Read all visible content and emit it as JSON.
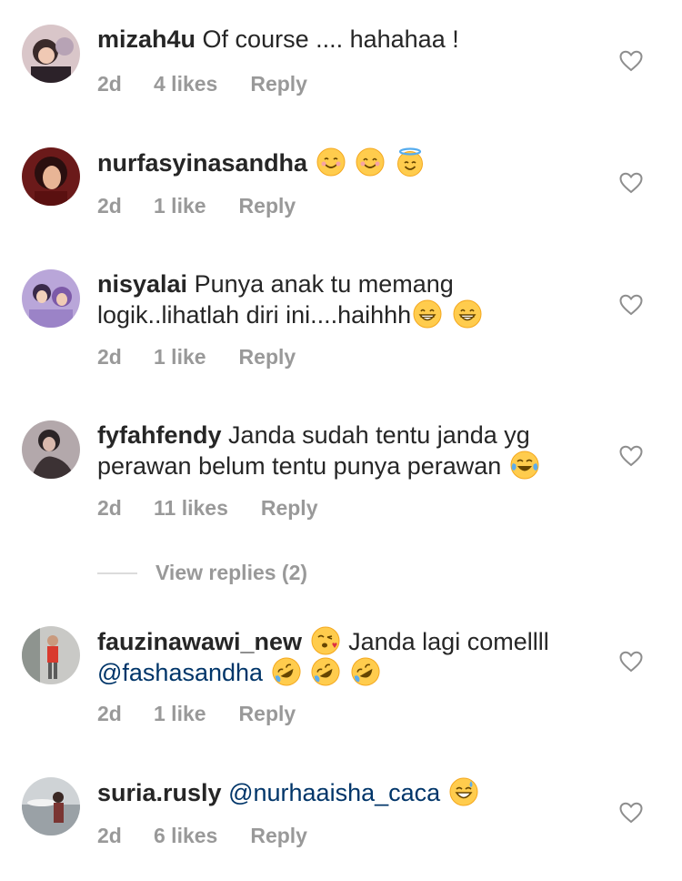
{
  "comments": [
    {
      "username": "mizah4u",
      "text": "Of course .... hahahaa !",
      "time": "2d",
      "likes": "4 likes",
      "reply": "Reply"
    },
    {
      "username": "nurfasyinasandha",
      "text": "",
      "emojis": [
        "smiling-face-icon",
        "smiling-face-icon",
        "halo-face-icon"
      ],
      "time": "2d",
      "likes": "1 like",
      "reply": "Reply"
    },
    {
      "username": "nisyalai",
      "text": "Punya anak tu memang logik..lihatlah diri ini....haihhh",
      "emojis": [
        "grinning-face-icon",
        "grinning-face-icon"
      ],
      "time": "2d",
      "likes": "1 like",
      "reply": "Reply"
    },
    {
      "username": "fyfahfendy",
      "text": "Janda sudah tentu janda yg perawan belum tentu punya perawan",
      "emojis": [
        "tears-of-joy-icon"
      ],
      "time": "2d",
      "likes": "11 likes",
      "reply": "Reply",
      "view_replies": "View replies (2)"
    },
    {
      "username": "fauzinawawi_new",
      "text": "Janda lagi comellll",
      "mention": "@fashasandha",
      "emojis": [
        "kiss-face-icon",
        "rofl-icon",
        "rofl-icon",
        "rofl-icon"
      ],
      "time": "2d",
      "likes": "1 like",
      "reply": "Reply"
    },
    {
      "username": "suria.rusly",
      "mention": "@nurhaaisha_caca",
      "emojis": [
        "sweat-smile-icon"
      ],
      "time": "2d",
      "likes": "6 likes",
      "reply": "Reply"
    }
  ],
  "colors": {
    "text": "#262626",
    "meta": "#999999",
    "mention": "#003569",
    "emoji": "#FFCC4D"
  }
}
